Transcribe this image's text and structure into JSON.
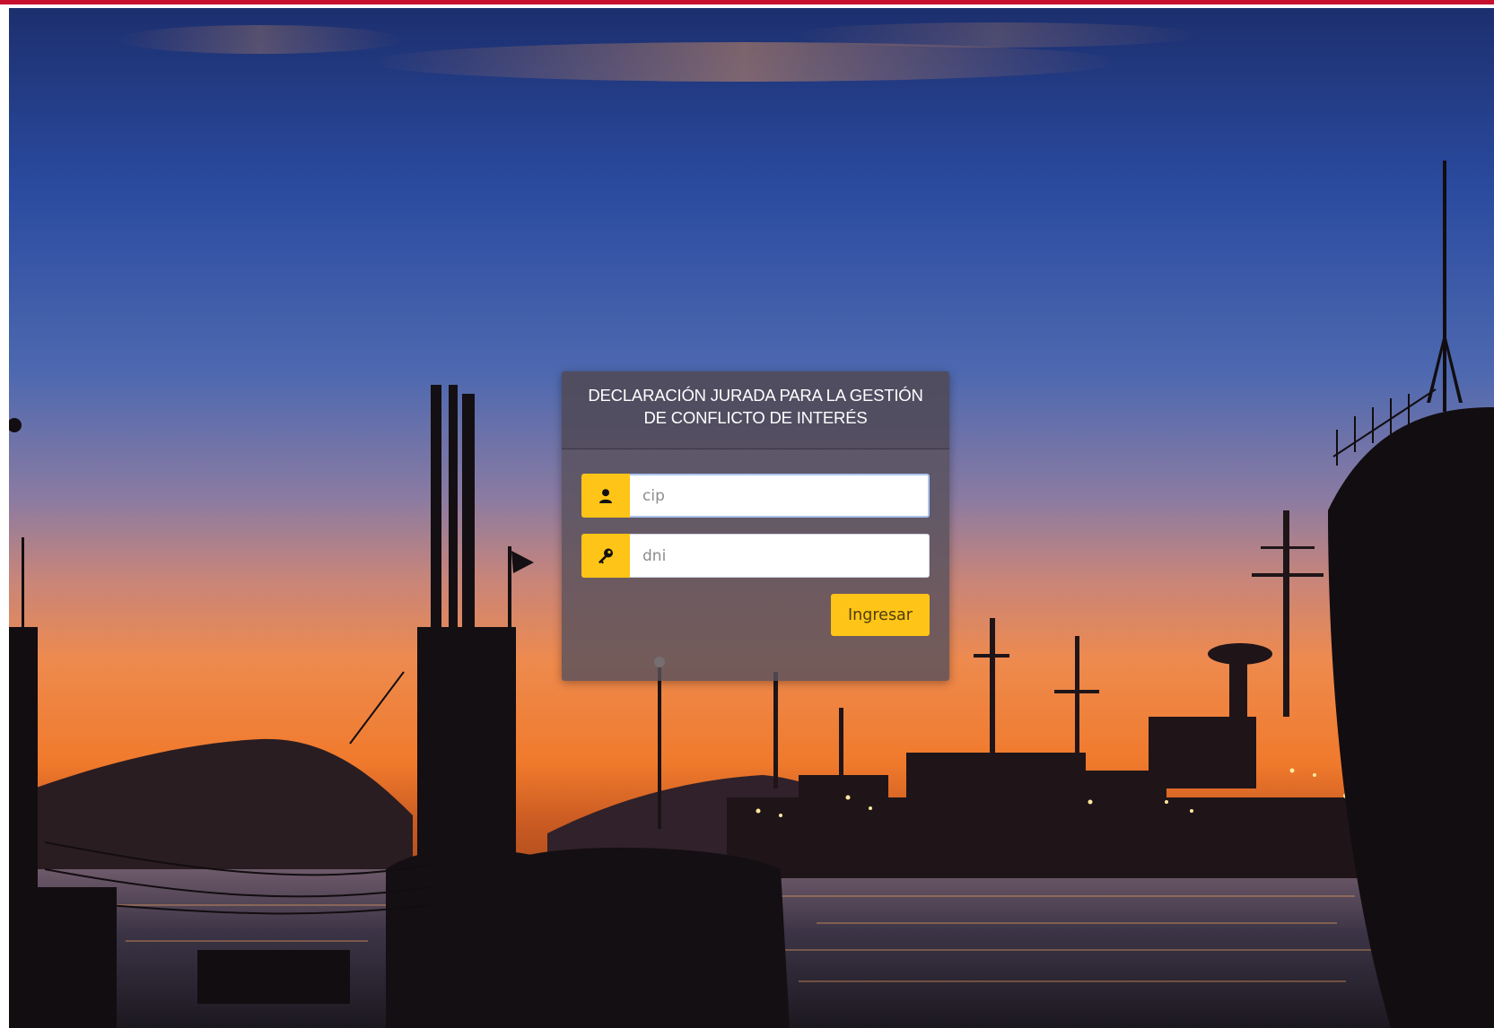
{
  "login": {
    "title": "DECLARACIÓN JURADA PARA LA GESTIÓN DE CONFLICTO DE INTERÉS",
    "cip_placeholder": "cip",
    "dni_placeholder": "dni",
    "submit_label": "Ingresar"
  },
  "icons": {
    "cip": "user-icon",
    "dni": "key-icon"
  },
  "colors": {
    "top_bar": "#c8102e",
    "accent": "#ffc418"
  }
}
